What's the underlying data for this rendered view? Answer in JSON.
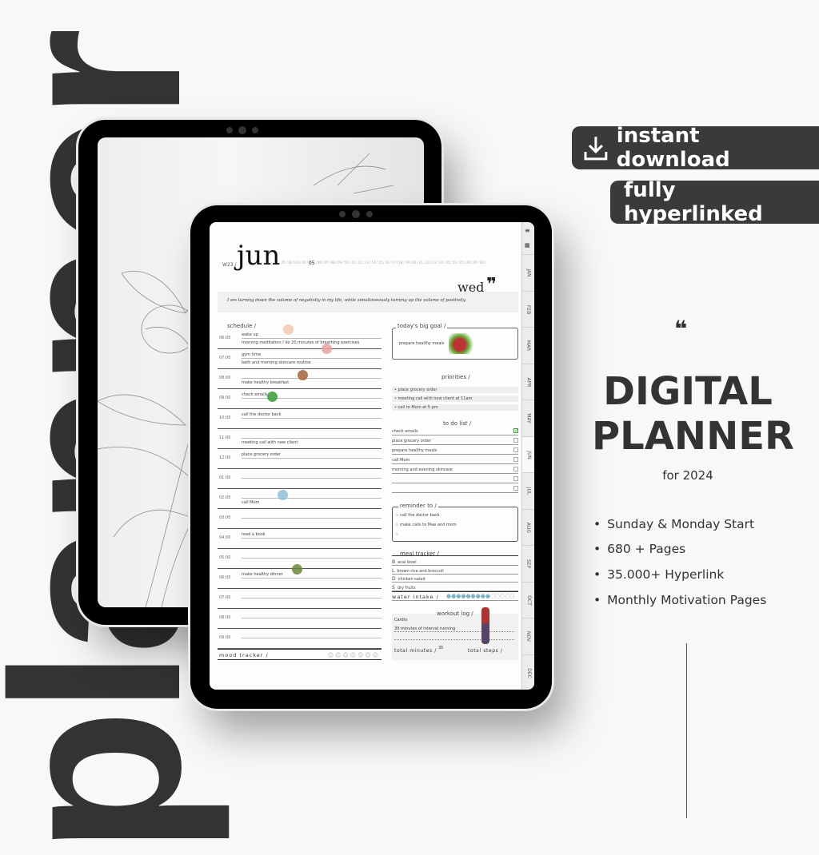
{
  "background_word": "planner",
  "badges": {
    "instant_download": "instant download",
    "fully_hyperlinked": "fully hyperlinked"
  },
  "hero": {
    "quote_mark": "❝",
    "title_line1": "DIGITAL",
    "title_line2": "PLANNER",
    "subtitle": "for 2024"
  },
  "features": [
    "Sunday & Monday Start",
    "680 + Pages",
    "35.000+ Hyperlink",
    "Monthly Motivation Pages"
  ],
  "planner": {
    "week": "W23 /",
    "month": "jun",
    "day": "wed",
    "quote_mark": "❞",
    "dates": [
      "01",
      "02",
      "03",
      "04",
      "05",
      "06",
      "07",
      "08",
      "09",
      "10",
      "11",
      "12",
      "13",
      "14",
      "15",
      "16",
      "17",
      "18",
      "19",
      "20",
      "21",
      "22",
      "23",
      "24",
      "25",
      "26",
      "27",
      "28",
      "29",
      "30"
    ],
    "selected_date": "05",
    "quote": "I am turning down the volume of negativity in my life, while simultaneously turning up the volume of positivity.",
    "schedule_title": "schedule /",
    "schedule": [
      {
        "time": "06:00",
        "a": "wake up",
        "b": "morning meditation / do 20 minutes of breathing exercises"
      },
      {
        "time": "07:00",
        "a": "gym time",
        "b": "bath and morning skincare routine"
      },
      {
        "time": "08:00",
        "a": "",
        "b": "make healthy breakfast"
      },
      {
        "time": "09:00",
        "a": "check emails",
        "b": ""
      },
      {
        "time": "10:00",
        "a": "call the doctor back",
        "b": ""
      },
      {
        "time": "11:00",
        "a": "",
        "b": "meeting call with new client"
      },
      {
        "time": "12:00",
        "a": "place grocery order",
        "b": ""
      },
      {
        "time": "01:00",
        "a": "",
        "b": ""
      },
      {
        "time": "02:00",
        "a": "",
        "b": "call Mom"
      },
      {
        "time": "03:00",
        "a": "",
        "b": ""
      },
      {
        "time": "04:00",
        "a": "read a book",
        "b": ""
      },
      {
        "time": "05:00",
        "a": "",
        "b": ""
      },
      {
        "time": "06:00",
        "a": "make healthy dinner",
        "b": ""
      },
      {
        "time": "07:00",
        "a": "",
        "b": ""
      },
      {
        "time": "08:00",
        "a": "",
        "b": ""
      },
      {
        "time": "09:00",
        "a": "",
        "b": ""
      }
    ],
    "mood_tracker": "mood tracker /",
    "big_goal_title": "today's big goal /",
    "big_goal": "prepare healthy meals",
    "priorities_title": "priorities /",
    "priorities": [
      "place grocery order",
      "meeting call with new client at 11am",
      "call to Mom at 5 pm"
    ],
    "todo_title": "to do list /",
    "todos": [
      {
        "text": "check emails",
        "done": true
      },
      {
        "text": "place grocery order",
        "done": false
      },
      {
        "text": "prepare healthy meals",
        "done": false
      },
      {
        "text": "call Mom",
        "done": false
      },
      {
        "text": "morning and evening skincare",
        "done": false
      },
      {
        "text": "",
        "done": false
      },
      {
        "text": "",
        "done": false
      }
    ],
    "reminder_title": "reminder to /",
    "reminders": [
      "call the doctor back",
      "make calls to Mae and mom",
      ""
    ],
    "meal_title": "meal tracker /",
    "meals": [
      {
        "k": "B",
        "v": "acai bowl"
      },
      {
        "k": "L",
        "v": "brown rice and broccoli"
      },
      {
        "k": "D",
        "v": "chicken salad"
      },
      {
        "k": "S",
        "v": "dry fruits"
      }
    ],
    "water_label": "water intake /",
    "water_filled": 9,
    "water_total": 14,
    "workout_title": "workout log /",
    "workout_type": "Cardio",
    "workout_desc": "30 minutes of interval running",
    "total_minutes_label": "total minutes /",
    "total_minutes": "35",
    "total_steps_label": "total steps /",
    "tabs": [
      "JAN",
      "FEB",
      "MAR",
      "APR",
      "MAY",
      "JUN",
      "JUL",
      "AUG",
      "SEP",
      "OCT",
      "NOV",
      "DEC"
    ]
  },
  "colors": {
    "dark": "#333333",
    "badge": "#3a3a3a",
    "bg": "#f8f8f8",
    "check": "#3a9a3a",
    "water": "#7fb3c9"
  }
}
